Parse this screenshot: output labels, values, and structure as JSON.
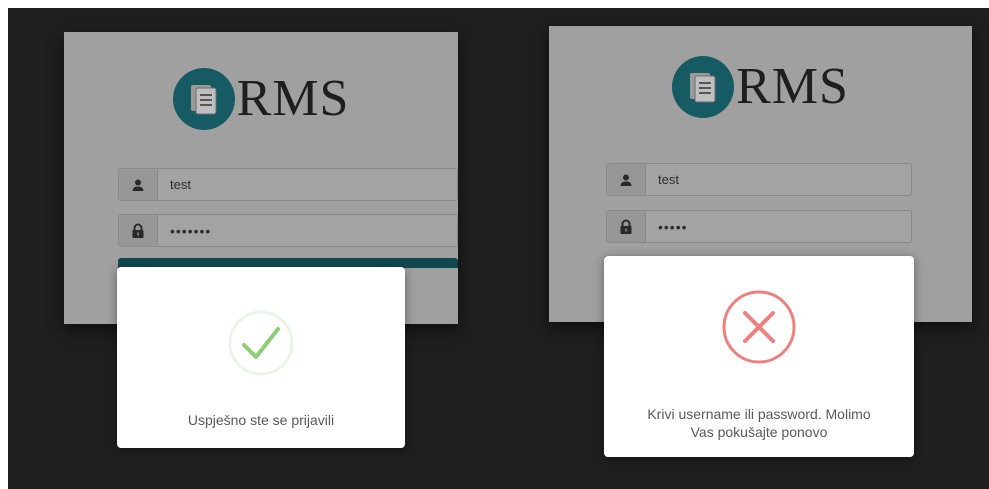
{
  "screens": {
    "success": {
      "app_logo_text": "RMS",
      "username_value": "test",
      "password_value": "•••••••",
      "modal_message": "Uspješno ste se prijavili"
    },
    "error": {
      "app_logo_text": "RMS",
      "username_value": "test",
      "password_value": "•••••",
      "modal_message_line1": "Krivi username ili password. Molimo",
      "modal_message_line2": "Vas pokušajte ponovo"
    }
  },
  "icons": {
    "logo": "document-icon",
    "username": "user-icon",
    "password": "lock-icon",
    "success": "checkmark-icon",
    "error": "close-icon"
  },
  "colors": {
    "logo_circle": "#165a63",
    "button": "#114850",
    "success": "#8ccf76",
    "error": "#f07f7f"
  }
}
